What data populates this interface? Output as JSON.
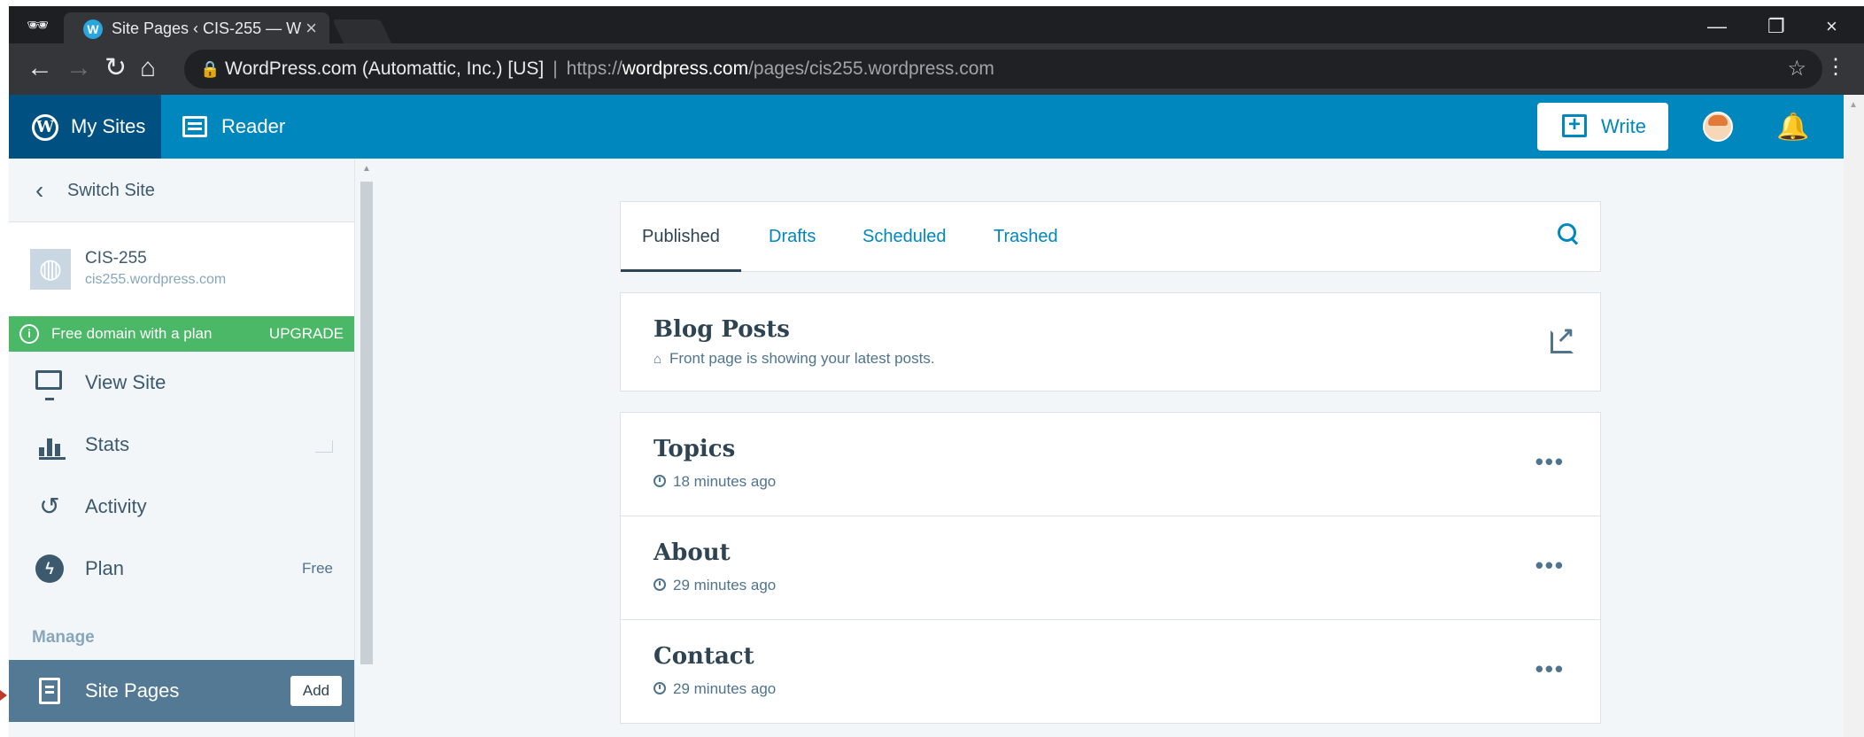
{
  "browser": {
    "tab_title": "Site Pages ‹ CIS-255 — W",
    "tab_favicon": "W",
    "close_glyph": "×",
    "url_owner": "WordPress.com (Automattic, Inc.) [US]",
    "url_scheme": "https://",
    "url_host": "wordpress.com",
    "url_path": "/pages/cis255.wordpress.com"
  },
  "masterbar": {
    "my_sites": "My Sites",
    "reader": "Reader",
    "write": "Write",
    "accent_color": "#0087be"
  },
  "sidebar": {
    "switch_site": "Switch Site",
    "site_name": "CIS-255",
    "site_url": "cis255.wordpress.com",
    "domain_banner": "Free domain with a plan",
    "upgrade": "UPGRADE",
    "items": [
      {
        "label": "View Site",
        "icon": "monitor-icon"
      },
      {
        "label": "Stats",
        "icon": "stats-icon"
      },
      {
        "label": "Activity",
        "icon": "activity-icon"
      },
      {
        "label": "Plan",
        "icon": "plan-icon",
        "badge": "Free"
      }
    ],
    "manage_heading": "Manage",
    "active_item": {
      "label": "Site Pages",
      "icon": "page-icon",
      "action": "Add"
    }
  },
  "main": {
    "tabs": [
      "Published",
      "Drafts",
      "Scheduled",
      "Trashed"
    ],
    "active_tab": "Published",
    "blog_posts": {
      "title": "Blog Posts",
      "subtitle": "Front page is showing your latest posts."
    },
    "pages": [
      {
        "title": "Topics",
        "time": "18 minutes ago"
      },
      {
        "title": "About",
        "time": "29 minutes ago"
      },
      {
        "title": "Contact",
        "time": "29 minutes ago"
      }
    ]
  }
}
